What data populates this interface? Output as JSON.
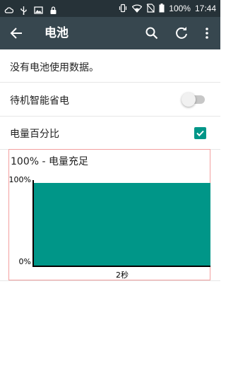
{
  "status_bar": {
    "left_icons": [
      "cloud-icon",
      "usb-icon",
      "image-icon",
      "lock-icon"
    ],
    "right_icons": [
      "vibrate-icon",
      "wifi-icon",
      "no-sim-icon",
      "battery-icon"
    ],
    "battery_text": "100%",
    "time": "17:44"
  },
  "app_bar": {
    "title": "电池",
    "back_icon": "arrow-back-icon",
    "actions": [
      "search-icon",
      "refresh-icon",
      "more-vert-icon"
    ]
  },
  "list": {
    "no_data_text": "没有电池使用数据。",
    "smart_saving_label": "待机智能省电",
    "smart_saving_enabled": false,
    "percentage_label": "电量百分比",
    "percentage_checked": true
  },
  "chart_data": {
    "type": "area",
    "title": "100% - 电量充足",
    "y_tick_labels": [
      "100%",
      "0%"
    ],
    "ylim": [
      0,
      100
    ],
    "x_label": "2秒",
    "values": [
      100,
      100
    ],
    "fill_color": "#009688"
  },
  "colors": {
    "status_bar": "#263238",
    "app_bar": "#37474f",
    "accent": "#009688",
    "chart_border": "#f4a0a0"
  }
}
